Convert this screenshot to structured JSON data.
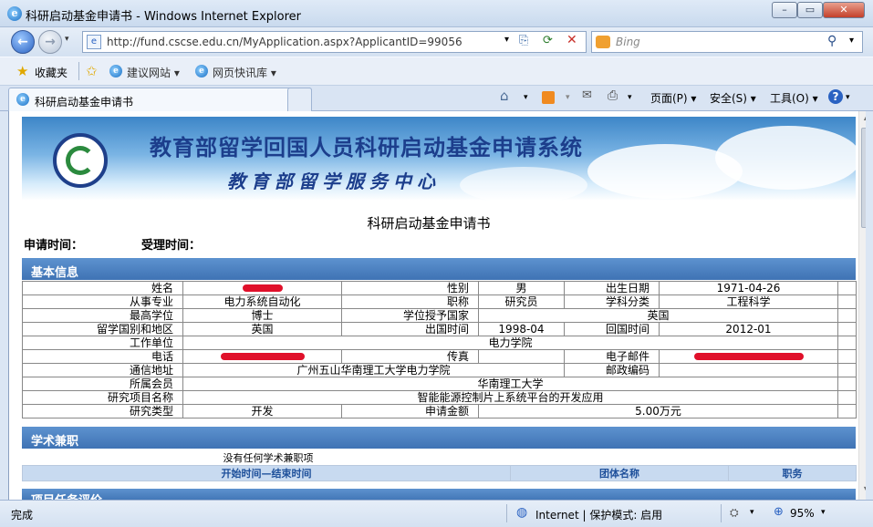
{
  "window": {
    "title": "科研启动基金申请书 - Windows Internet Explorer"
  },
  "address": {
    "url": "http://fund.cscse.edu.cn/MyApplication.aspx?ApplicantID=99056",
    "search_placeholder": "Bing"
  },
  "favorites": {
    "label": "收藏夹",
    "items": [
      "建议网站 ▾",
      "网页快讯库 ▾"
    ]
  },
  "tab": {
    "title": "科研启动基金申请书"
  },
  "command_bar": {
    "page": "页面(P) ▾",
    "safety": "安全(S) ▾",
    "tools": "工具(O) ▾",
    "help": "?"
  },
  "banner": {
    "title": "教育部留学回国人员科研启动基金申请系统",
    "subtitle": "教育部留学服务中心"
  },
  "document": {
    "title": "科研启动基金申请书",
    "apply_time_label": "申请时间：",
    "accept_time_label": "受理时间："
  },
  "basic_info": {
    "header": "基本信息",
    "name_label": "姓名",
    "gender_label": "性别",
    "gender": "男",
    "birth_label": "出生日期",
    "birth": "1971-04-26",
    "major_label": "从事专业",
    "major": "电力系统自动化",
    "title_label": "职称",
    "title": "研究员",
    "discipline_label": "学科分类",
    "discipline": "工程科学",
    "degree_label": "最高学位",
    "degree": "博士",
    "degree_country_label": "学位授予国家",
    "degree_country": "英国",
    "study_country_label": "留学国别和地区",
    "study_country": "英国",
    "depart_label": "出国时间",
    "depart": "1998-04",
    "return_label": "回国时间",
    "return": "2012-01",
    "employer_label": "工作单位",
    "employer": "电力学院",
    "phone_label": "电话",
    "fax_label": "传真",
    "email_label": "电子邮件",
    "address_label": "通信地址",
    "address": "广州五山华南理工大学电力学院",
    "postcode_label": "邮政编码",
    "member_label": "所属会员",
    "member": "华南理工大学",
    "project_label": "研究项目名称",
    "project": "智能能源控制片上系统平台的开发应用",
    "type_label": "研究类型",
    "type": "开发",
    "amount_label": "申请金额",
    "amount": "5.00万元"
  },
  "academic": {
    "header": "学术兼职",
    "empty": "没有任何学术兼职项",
    "columns": [
      "开始时间—结束时间",
      "团体名称",
      "职务"
    ]
  },
  "next_section": {
    "header": "项目任务评价"
  },
  "statusbar": {
    "left": "完成",
    "zone": "Internet | 保护模式: 启用",
    "zoom": "95%"
  },
  "colors": {
    "section_bar": "#4a7fbf",
    "banner_title": "#1c3e8c",
    "redaction": "#e0102a"
  }
}
